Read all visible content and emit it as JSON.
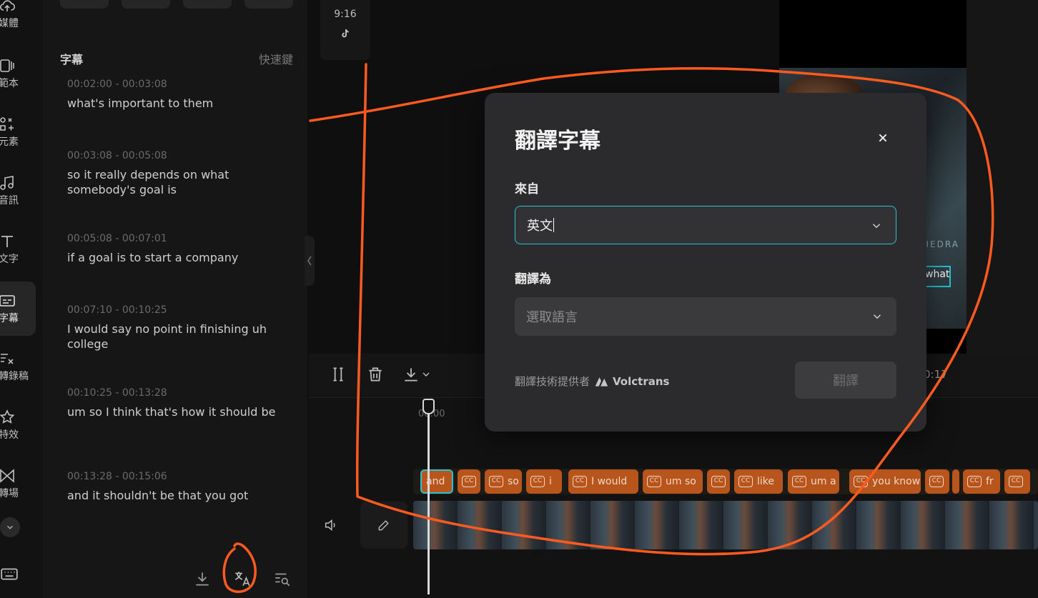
{
  "rail": {
    "items": [
      {
        "label": "媒體",
        "icon": "cloud-upload-icon"
      },
      {
        "label": "範本",
        "icon": "template-icon"
      },
      {
        "label": "元素",
        "icon": "elements-icon"
      },
      {
        "label": "音訊",
        "icon": "music-note-icon"
      },
      {
        "label": "文字",
        "icon": "text-icon"
      },
      {
        "label": "字幕",
        "icon": "captions-icon",
        "active": true
      },
      {
        "label": "轉錄稿",
        "icon": "transcript-icon"
      },
      {
        "label": "特效",
        "icon": "effects-star-icon"
      },
      {
        "label": "轉場",
        "icon": "transitions-icon"
      }
    ]
  },
  "panel": {
    "title": "字幕",
    "shortcut_link": "快速鍵",
    "captions": [
      {
        "time": "00:02:00 - 00:03:08",
        "text": "what's important to them"
      },
      {
        "time": "00:03:08 - 00:05:08",
        "text": "so it really depends on what somebody's goal is"
      },
      {
        "time": "00:05:08 - 00:07:01",
        "text": "if a goal is to start a company"
      },
      {
        "time": "00:07:10 - 00:10:25",
        "text": "I would say no point in finishing uh college"
      },
      {
        "time": "00:10:25 - 00:13:28",
        "text": "um so I think that's how it should be"
      },
      {
        "time": "00:13:28 - 00:15:06",
        "text": "and it shouldn't be that you got"
      }
    ]
  },
  "aspect": {
    "ratio": "9:16",
    "platform_icon": "tiktok-icon"
  },
  "preview": {
    "watermark": "HEDRA",
    "caption_fragment": "what"
  },
  "toolbar": {
    "time": "0:17"
  },
  "timeline": {
    "ruler_start": "00:00",
    "caption_clips": [
      {
        "label": "and"
      },
      {
        "label": ""
      },
      {
        "label": "so"
      },
      {
        "label": "i"
      },
      {
        "label": "I would"
      },
      {
        "label": "um so"
      },
      {
        "label": ""
      },
      {
        "label": "like"
      },
      {
        "label": "um a"
      },
      {
        "label": "you know"
      },
      {
        "label": ""
      },
      {
        "label": ""
      },
      {
        "label": "fr"
      },
      {
        "label": ""
      }
    ]
  },
  "modal": {
    "title": "翻譯字幕",
    "from_label": "來自",
    "from_value": "英文",
    "to_label": "翻譯為",
    "to_placeholder": "選取語言",
    "provider_text": "翻譯技術提供者",
    "provider_name": "Volctrans",
    "translate_button": "翻譯"
  },
  "colors": {
    "accent_cyan": "#29c2cf",
    "clip_orange": "#b8551c",
    "annotation": "#ff5a1f"
  }
}
